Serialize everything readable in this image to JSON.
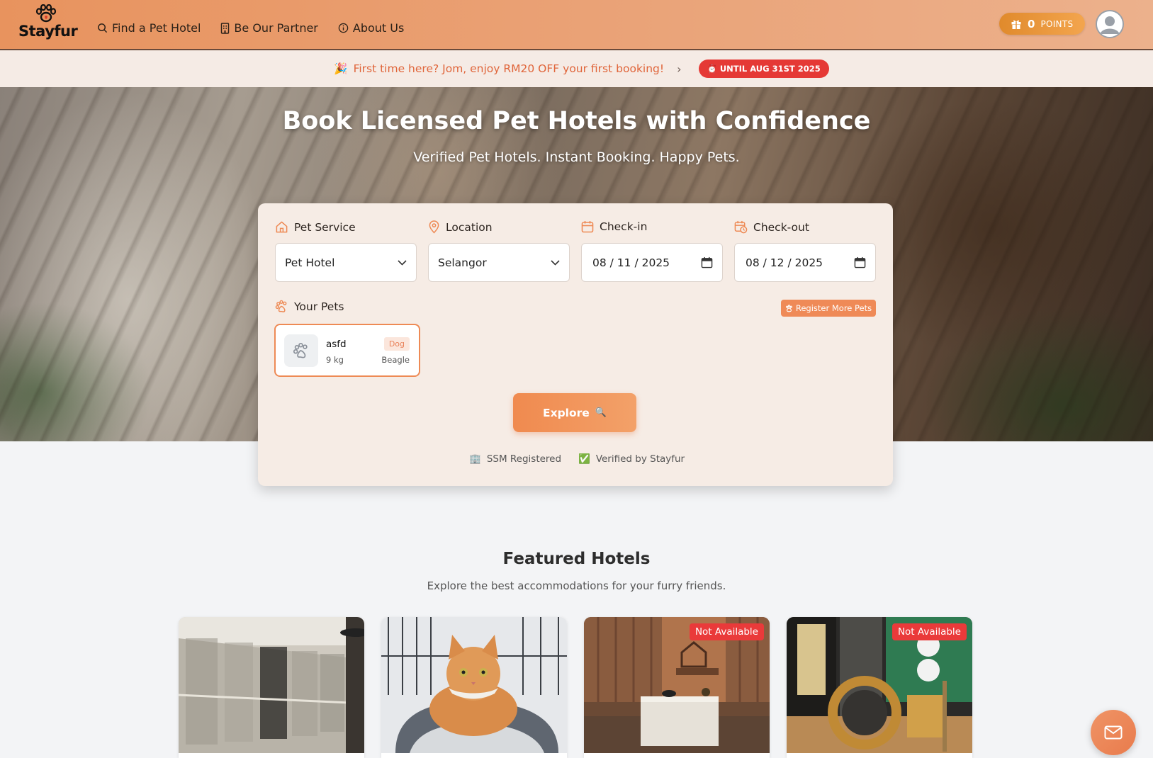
{
  "brand": {
    "name": "Stayfur",
    "logo_icon": "paw-icon"
  },
  "nav": [
    {
      "label": "Find a Pet Hotel",
      "icon": "search-icon"
    },
    {
      "label": "Be Our Partner",
      "icon": "building-icon"
    },
    {
      "label": "About Us",
      "icon": "info-icon"
    }
  ],
  "points": {
    "value": "0",
    "label": "POINTS",
    "icon": "gift-icon"
  },
  "promo": {
    "emoji": "🎉",
    "text": "First time here? Jom, enjoy RM20 OFF your first booking!",
    "badge_emoji": "⏰",
    "badge": "UNTIL AUG 31ST 2025"
  },
  "hero": {
    "title": "Book Licensed Pet Hotels with Confidence",
    "subtitle": "Verified Pet Hotels. Instant Booking. Happy Pets."
  },
  "search": {
    "pet_service": {
      "label": "Pet Service",
      "value": "Pet Hotel"
    },
    "location": {
      "label": "Location",
      "value": "Selangor"
    },
    "checkin": {
      "label": "Check-in",
      "value": "08 / 11 / 2025"
    },
    "checkout": {
      "label": "Check-out",
      "value": "08 / 12 / 2025"
    },
    "your_pets_label": "Your Pets",
    "register_more_label": "Register More Pets",
    "pets": [
      {
        "name": "asfd",
        "weight": "9 kg",
        "type": "Dog",
        "breed": "Beagle"
      }
    ],
    "explore_label": "Explore",
    "explore_emoji": "🔍",
    "trust": [
      {
        "emoji": "🏢",
        "label": "SSM Registered"
      },
      {
        "emoji": "✅",
        "label": "Verified by Stayfur"
      }
    ]
  },
  "featured": {
    "title": "Featured Hotels",
    "subtitle": "Explore the best accommodations for your furry friends.",
    "hotels": [
      {
        "badge": ""
      },
      {
        "badge": ""
      },
      {
        "badge": "Not Available"
      },
      {
        "badge": "Not Available"
      }
    ]
  },
  "colors": {
    "accent": "#ef8a57",
    "badge_red": "#e53935"
  }
}
